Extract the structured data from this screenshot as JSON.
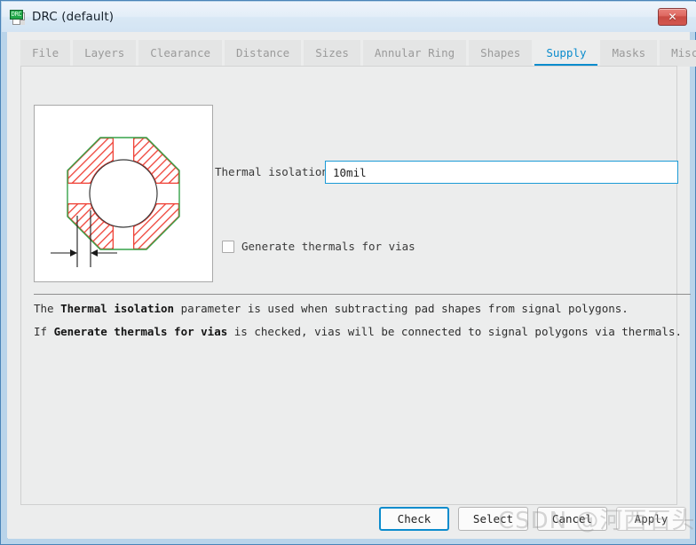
{
  "window": {
    "title": "DRC (default)",
    "icon": "drc-document-icon",
    "icon_text": "DRC",
    "close_label": "✕",
    "accent_color": "#0b8ccd",
    "titlebar_color": "#d9e8f5",
    "frame_color": "#b9d4ea",
    "body_color": "#eceded"
  },
  "tabs": [
    {
      "label": "File",
      "active": false
    },
    {
      "label": "Layers",
      "active": false
    },
    {
      "label": "Clearance",
      "active": false
    },
    {
      "label": "Distance",
      "active": false
    },
    {
      "label": "Sizes",
      "active": false
    },
    {
      "label": "Annular Ring",
      "active": false
    },
    {
      "label": "Shapes",
      "active": false
    },
    {
      "label": "Supply",
      "active": true
    },
    {
      "label": "Masks",
      "active": false
    },
    {
      "label": "Misc",
      "active": false
    }
  ],
  "illustration": {
    "name": "thermal-isolation-diagram",
    "pad_outline_color": "#35a349",
    "hatch_color": "#ef4136",
    "ring_color": "#2d2d2d",
    "dimension_color": "#1a1a1a",
    "description": "Octagonal pad with thermal relief spokes and isolation gap dimension"
  },
  "form": {
    "thermal_isolation": {
      "label": "Thermal isolation",
      "value": "10mil",
      "placeholder": "",
      "focused": true
    },
    "generate_thermals": {
      "label": "Generate thermals for vias",
      "checked": false
    }
  },
  "description": {
    "line1": {
      "pre": "The ",
      "bold": "Thermal isolation",
      "post": " parameter is used when subtracting pad shapes from signal polygons."
    },
    "line2": {
      "pre": "If ",
      "bold": "Generate thermals for vias",
      "post": " is checked, vias will be connected to signal polygons via thermals."
    }
  },
  "footer": {
    "buttons": [
      {
        "label": "Check",
        "default": true
      },
      {
        "label": "Select",
        "default": false
      },
      {
        "label": "Cancel",
        "default": false
      },
      {
        "label": "Apply",
        "default": false
      }
    ]
  },
  "watermark": {
    "text": "CSDN @河西石头"
  }
}
